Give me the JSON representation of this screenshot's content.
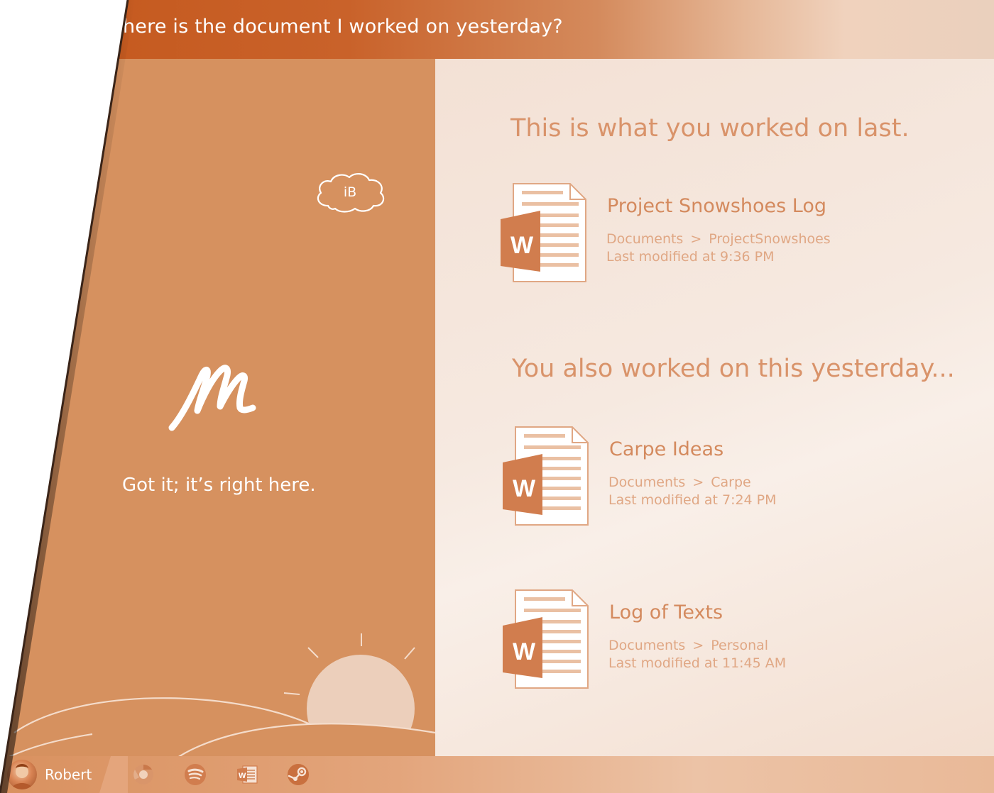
{
  "query": {
    "text": "here is the document I worked on yesterday?"
  },
  "assistant": {
    "cloud_badge_label": "iB",
    "logo_icon": "handwritten-m-logo",
    "reply": "Got it; it’s right here."
  },
  "results": {
    "primary_heading": "This is what you worked on last.",
    "primary_doc": {
      "icon": "word-document-icon",
      "title": "Project Snowshoes Log",
      "path_root": "Documents",
      "path_separator": ">",
      "path_folder": "ProjectSnowshoes",
      "modified": "Last modified at 9:36 PM"
    },
    "secondary_heading": "You also worked on this yesterday...",
    "secondary_docs": [
      {
        "icon": "word-document-icon",
        "title": "Carpe Ideas",
        "path_root": "Documents",
        "path_separator": ">",
        "path_folder": "Carpe",
        "modified": "Last modified at 7:24 PM"
      },
      {
        "icon": "word-document-icon",
        "title": "Log of Texts",
        "path_root": "Documents",
        "path_separator": ">",
        "path_folder": "Personal",
        "modified": "Last modified at 11:45 AM"
      }
    ]
  },
  "taskbar": {
    "user_name": "Robert",
    "apps": [
      "chrome-icon",
      "spotify-icon",
      "word-icon",
      "steam-icon"
    ]
  },
  "colors": {
    "accent": "#c4571b",
    "panel": "#d6915f",
    "heading_text": "#d9936a",
    "muted_text": "#e0a784"
  }
}
